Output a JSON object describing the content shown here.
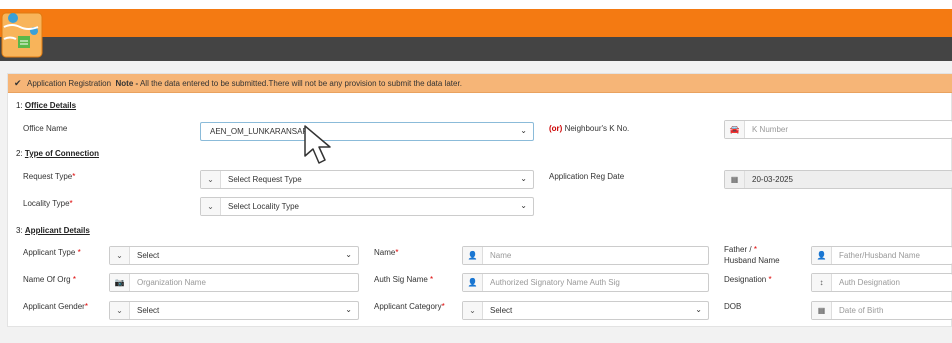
{
  "notice": {
    "prefix": "Application Registration",
    "note_label": "Note -",
    "note_text": "All the data entered to be submitted.There will not be any provision to submit the data later."
  },
  "sections": {
    "office": {
      "num": "1:",
      "title": "Office Details"
    },
    "connection": {
      "num": "2:",
      "title": "Type of Connection"
    },
    "applicant": {
      "num": "3:",
      "title": "Applicant Details"
    }
  },
  "office": {
    "office_name_label": "Office Name",
    "office_name_value": "AEN_OM_LUNKARANSAR",
    "or_label": "(or)",
    "neighbour_label": "Neighbour's K No.",
    "k_number_placeholder": "K Number"
  },
  "connection": {
    "request_type_label": "Request Type",
    "request_type_value": "Select Request Type",
    "locality_type_label": "Locality Type",
    "locality_type_value": "Select Locality Type",
    "app_reg_date_label": "Application Reg Date",
    "app_reg_date_value": "20-03-2025"
  },
  "applicant": {
    "applicant_type_label": "Applicant Type",
    "applicant_type_value": "Select",
    "name_label": "Name",
    "name_placeholder": "Name",
    "father_label_1": "Father /",
    "father_label_2": "Husband Name",
    "father_placeholder": "Father/Husband Name",
    "org_label": "Name Of Org",
    "org_placeholder": "Organization Name",
    "auth_sig_label": "Auth Sig Name",
    "auth_sig_placeholder": "Authorized Signatory Name Auth Sig",
    "designation_label": "Designation",
    "designation_placeholder": "Auth Designation",
    "gender_label": "Applicant Gender",
    "gender_value": "Select",
    "category_label": "Applicant Category",
    "category_value": "Select",
    "dob_label": "DOB",
    "dob_placeholder": "Date of Birth"
  },
  "required_mark": "*",
  "colors": {
    "header_orange": "#f47a12",
    "header_dark": "#444444",
    "notice_bg": "#f6b577",
    "required": "#dd0000"
  },
  "icons": [
    "logo",
    "check-icon",
    "chevron-down-icon",
    "car-icon",
    "calendar-icon",
    "user-icon",
    "camera-icon",
    "sort-icon",
    "mouse-cursor"
  ]
}
